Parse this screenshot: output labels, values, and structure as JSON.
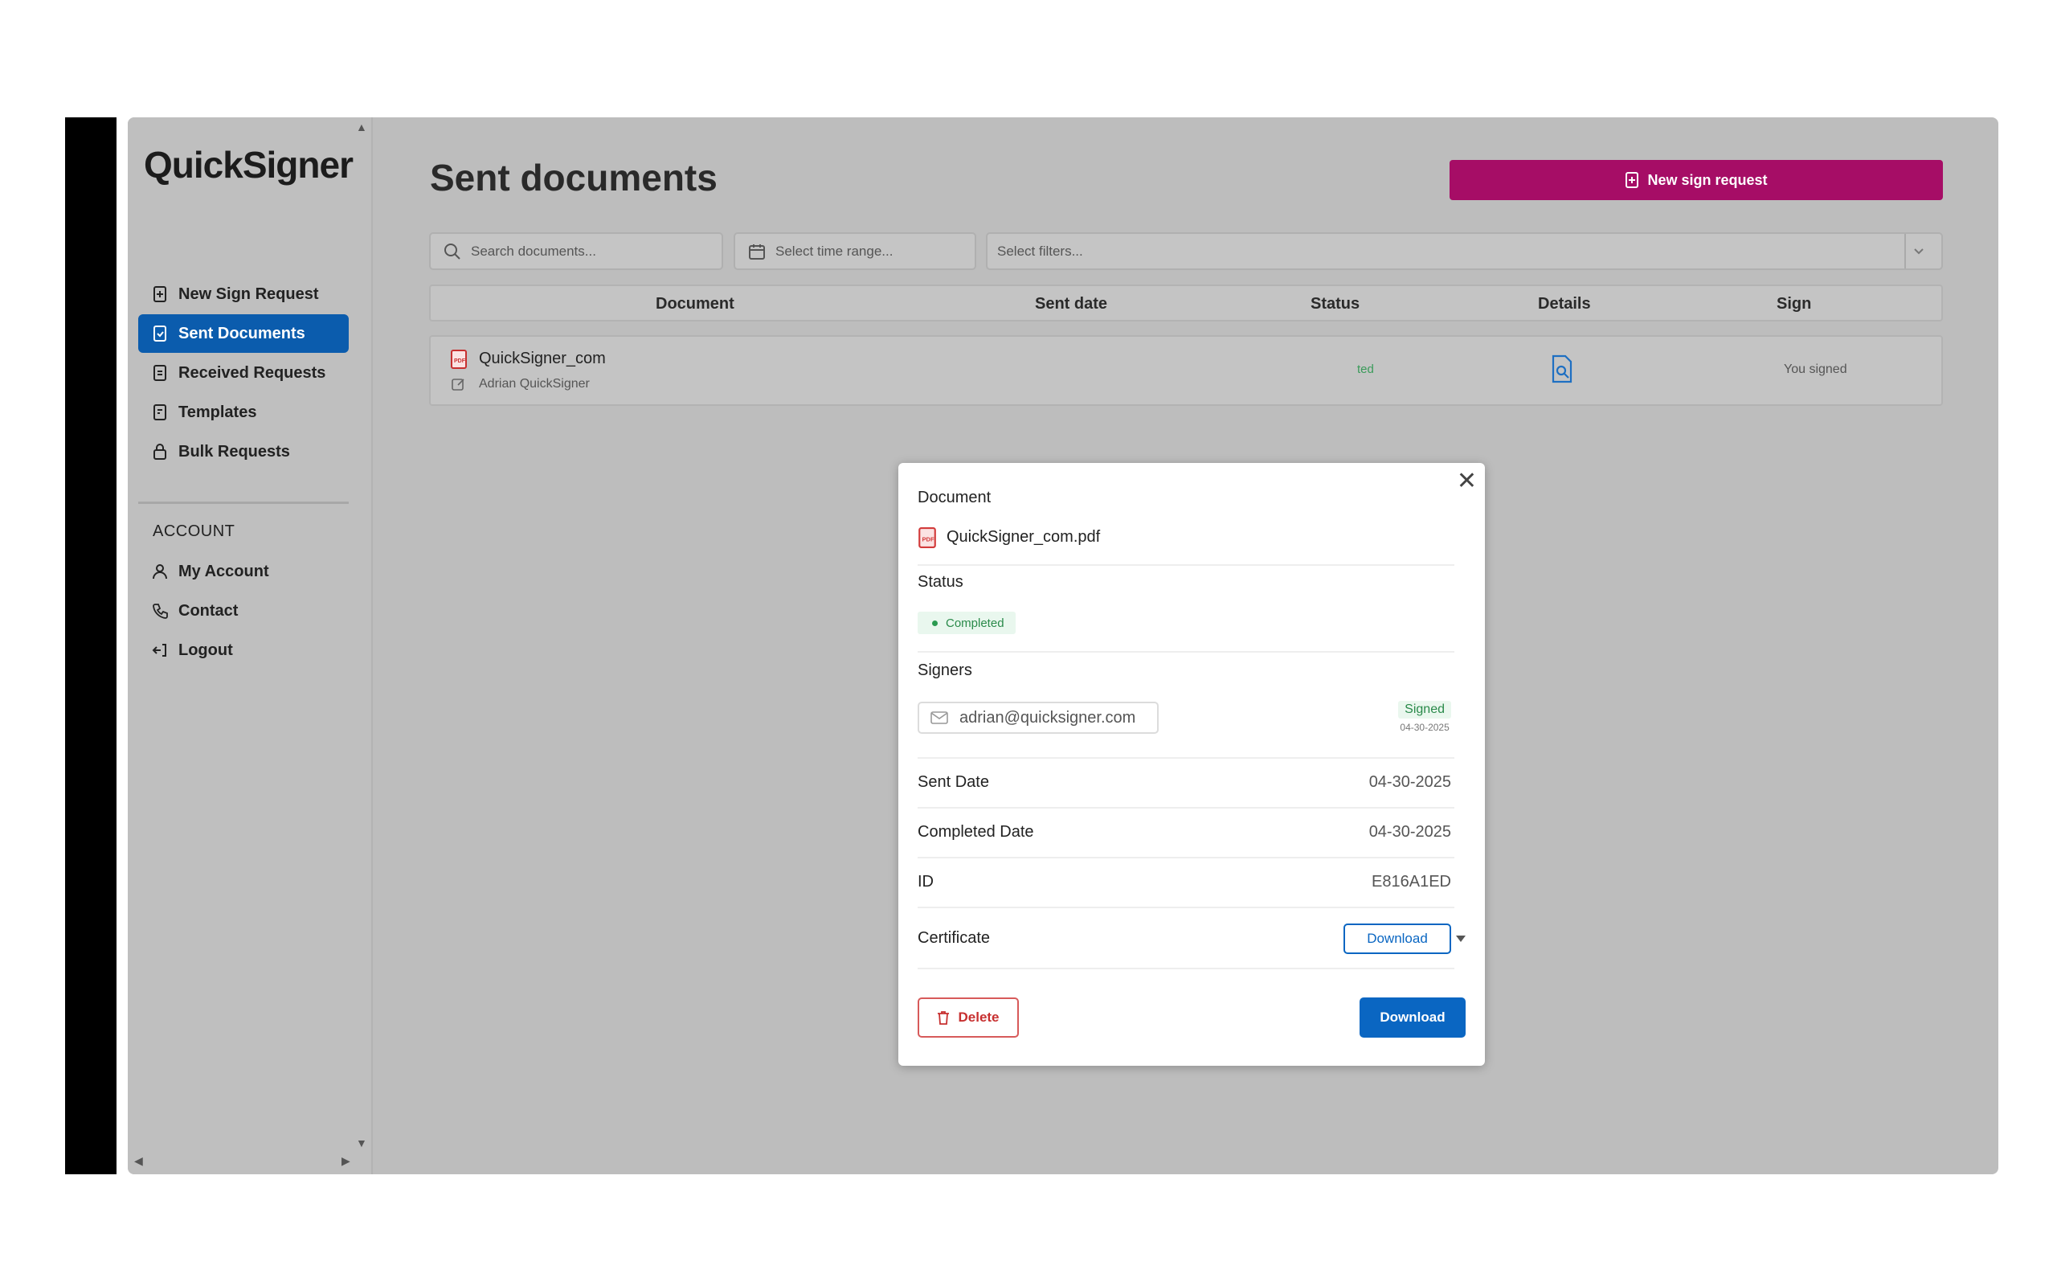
{
  "app": {
    "logo": "QuickSigner"
  },
  "sidebar": {
    "items": [
      {
        "label": "New Sign Request",
        "icon": "file-plus-icon"
      },
      {
        "label": "Sent Documents",
        "icon": "file-send-icon",
        "active": true
      },
      {
        "label": "Received Requests",
        "icon": "file-inbox-icon"
      },
      {
        "label": "Templates",
        "icon": "template-icon"
      },
      {
        "label": "Bulk Requests",
        "icon": "lock-icon"
      }
    ],
    "account_heading": "ACCOUNT",
    "account_items": [
      {
        "label": "My Account",
        "icon": "user-icon"
      },
      {
        "label": "Contact",
        "icon": "phone-icon"
      },
      {
        "label": "Logout",
        "icon": "logout-icon"
      }
    ]
  },
  "header": {
    "title": "Sent documents",
    "new_button_label": "New sign request"
  },
  "filters": {
    "search_placeholder": "Search documents...",
    "time_placeholder": "Select time range...",
    "filters_placeholder": "Select filters..."
  },
  "table": {
    "columns": [
      "Document",
      "Sent date",
      "Status",
      "Details",
      "Sign"
    ],
    "rows": [
      {
        "document": "QuickSigner_com",
        "sender": "Adrian QuickSigner",
        "status_partial": "ted",
        "sign": "You signed"
      }
    ]
  },
  "modal": {
    "document_label": "Document",
    "file_name": "QuickSigner_com.pdf",
    "status_label": "Status",
    "status_value": "Completed",
    "signers_label": "Signers",
    "signer_email": "adrian@quicksigner.com",
    "signer_status": "Signed",
    "signer_date": "04-30-2025",
    "sent_date_label": "Sent Date",
    "sent_date_value": "04-30-2025",
    "completed_date_label": "Completed Date",
    "completed_date_value": "04-30-2025",
    "id_label": "ID",
    "id_value": "E816A1ED",
    "certificate_label": "Certificate",
    "certificate_button": "Download",
    "delete_button": "Delete",
    "download_button": "Download"
  },
  "colors": {
    "primary": "#0a66c2",
    "brand_magenta": "#a60d66",
    "active_nav": "#0b5cad",
    "success": "#2a8a4a",
    "danger": "#c73030"
  }
}
